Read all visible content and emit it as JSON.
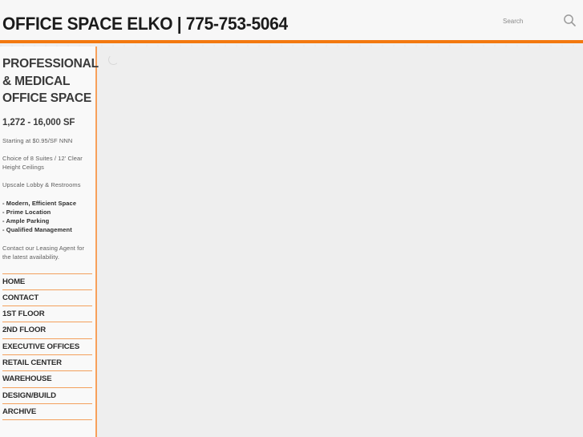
{
  "header": {
    "title": "OFFICE SPACE ELKO | 775-753-5064",
    "search": {
      "placeholder": "Search",
      "value": "",
      "icon": "search-icon"
    },
    "accent_color": "#f3780f",
    "background_color": "#f7f7f7"
  },
  "sidebar": {
    "heading": "PROFESSIONAL & MEDICAL OFFICE SPACE",
    "heading_lines": [
      "PROFESSIONAL",
      "& MEDICAL",
      "OFFICE SPACE"
    ],
    "size_range": "1,272 - 16,000 SF",
    "pricing": "Starting at $0.95/SF NNN",
    "suites": "Choice of 8 Suites / 12' Clear Height Ceilings",
    "lobby": "Upscale Lobby & Restrooms",
    "features": [
      "- Modern, Efficient Space",
      "- Prime Location",
      "- Ample Parking",
      "- Qualified Management"
    ],
    "contact": "Contact our Leasing Agent for the latest availability.",
    "nav": [
      {
        "label": "HOME"
      },
      {
        "label": "CONTACT"
      },
      {
        "label": "1ST FLOOR"
      },
      {
        "label": "2ND FLOOR"
      },
      {
        "label": "EXECUTIVE OFFICES"
      },
      {
        "label": "RETAIL CENTER"
      },
      {
        "label": "WAREHOUSE"
      },
      {
        "label": "DESIGN/BUILD"
      },
      {
        "label": "ARCHIVE"
      }
    ],
    "divider_color": "#f3a05c",
    "background_color": "#f9f9f9"
  },
  "main": {
    "status": "loading",
    "spinner_icon": "loading-spinner-icon",
    "background_color": "#eeeeee"
  }
}
